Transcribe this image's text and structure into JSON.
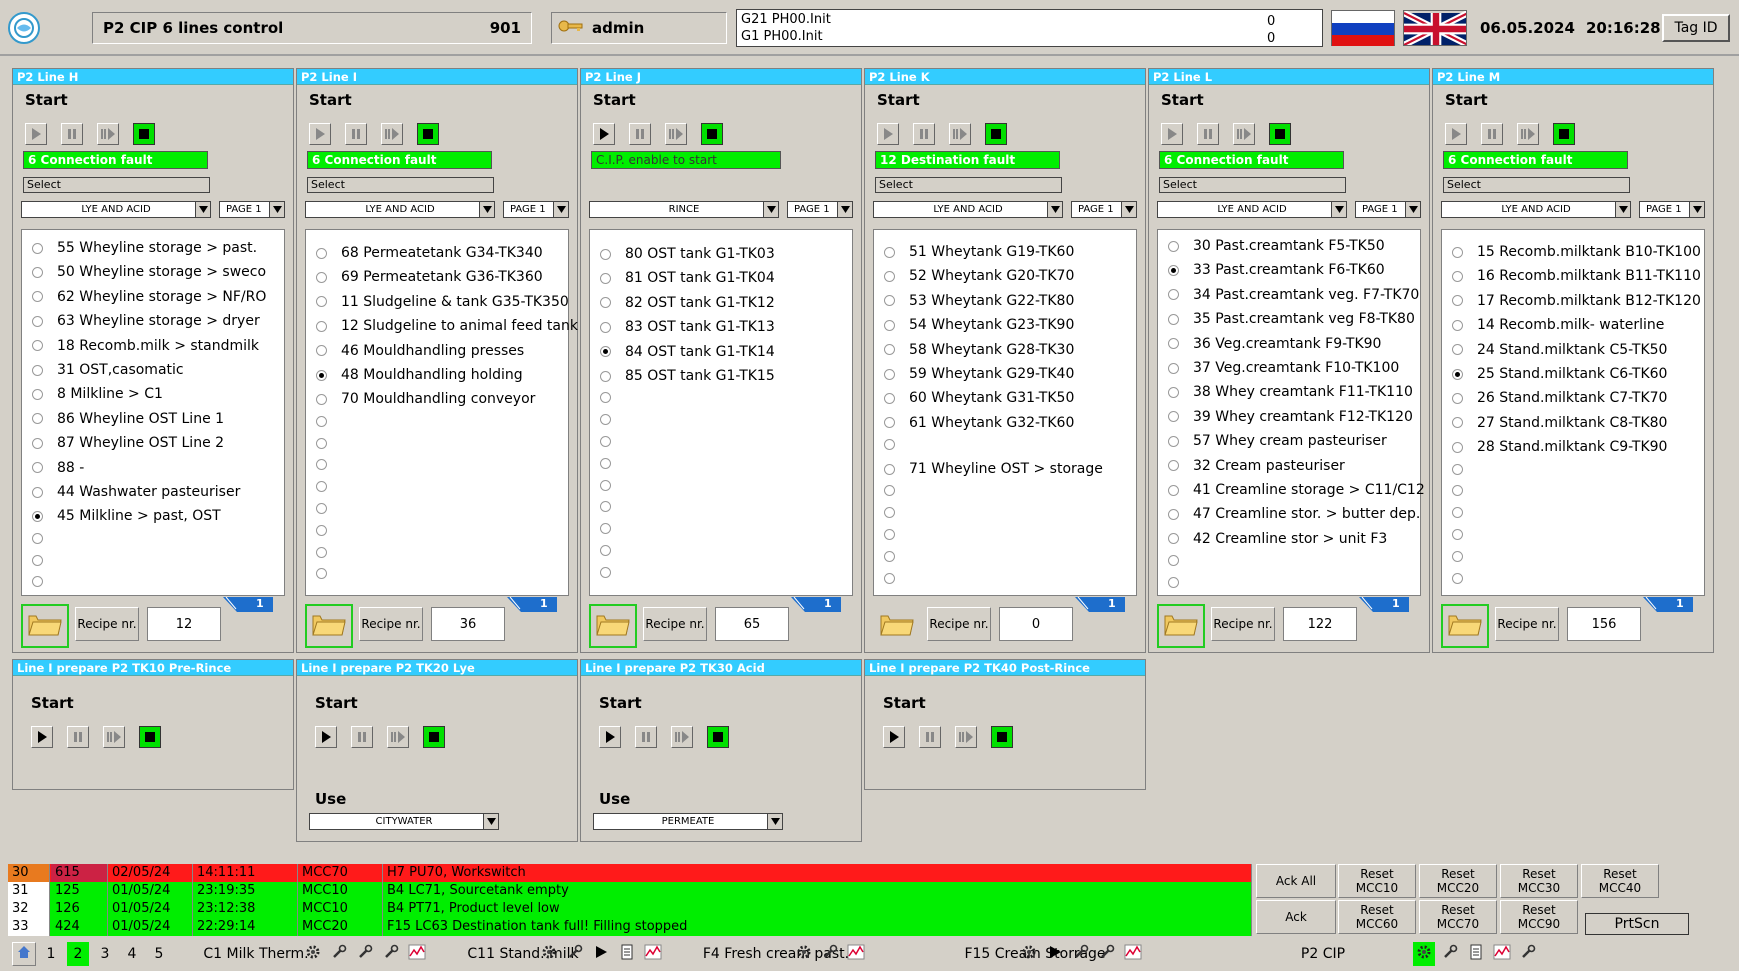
{
  "header": {
    "title": "P2 CIP 6 lines control",
    "code": "901",
    "user": "admin",
    "messages": [
      {
        "label": "G21  PH00.Init",
        "value": "0"
      },
      {
        "label": "G1   PH00.Init",
        "value": "0"
      }
    ],
    "date": "06.05.2024",
    "time": "20:16:28",
    "tag_id": "Tag ID"
  },
  "common": {
    "start": "Start",
    "select": "Select",
    "recipe_btn": "Recipe nr.",
    "use": "Use",
    "badge": "1"
  },
  "lines": [
    {
      "title": "P2 Line H",
      "fault": "6 Connection fault",
      "program": "LYE AND ACID",
      "page": "PAGE 1",
      "recipe": "12",
      "items": [
        {
          "t": "55 Wheyline storage > past.",
          "on": false
        },
        {
          "t": "50 Wheyline storage > sweco",
          "on": false
        },
        {
          "t": "62 Wheyline storage > NF/RO",
          "on": false
        },
        {
          "t": "63 Wheyline storage > dryer",
          "on": false
        },
        {
          "t": "18 Recomb.milk > standmilk",
          "on": false
        },
        {
          "t": "31 OST,casomatic",
          "on": false
        },
        {
          "t": "8 Milkline > C1",
          "on": false
        },
        {
          "t": "86 Wheyline OST  Line 1",
          "on": false
        },
        {
          "t": "87 Wheyline OST Line 2",
          "on": false
        },
        {
          "t": "88 -",
          "on": false
        },
        {
          "t": "44 Washwater pasteuriser",
          "on": false
        },
        {
          "t": "45 Milkline > past, OST",
          "on": true
        },
        {
          "t": "",
          "on": false
        },
        {
          "t": "",
          "on": false
        },
        {
          "t": "",
          "on": false
        }
      ]
    },
    {
      "title": "P2 Line I",
      "fault": "6 Connection fault",
      "program": "LYE AND ACID",
      "page": "PAGE 1",
      "recipe": "36",
      "items": [
        {
          "t": "68 Permeatetank G34-TK340",
          "on": false
        },
        {
          "t": "69 Permeatetank G36-TK360",
          "on": false
        },
        {
          "t": "11 Sludgeline & tank G35-TK350",
          "on": false
        },
        {
          "t": "12 Sludgeline to animal feed tank",
          "on": false
        },
        {
          "t": "46 Mouldhandling presses",
          "on": false
        },
        {
          "t": "48 Mouldhandling holding",
          "on": true
        },
        {
          "t": "70 Mouldhandling conveyor",
          "on": false
        },
        {
          "t": "",
          "on": false
        },
        {
          "t": "",
          "on": false
        },
        {
          "t": "",
          "on": false
        },
        {
          "t": "",
          "on": false
        },
        {
          "t": "",
          "on": false
        },
        {
          "t": "",
          "on": false
        },
        {
          "t": "",
          "on": false
        },
        {
          "t": "",
          "on": false
        }
      ]
    },
    {
      "title": "P2 Line J",
      "fault": "C.I.P. enable to start",
      "program": "RINCE",
      "page": "PAGE 1",
      "recipe": "65",
      "items": [
        {
          "t": "80 OST tank G1-TK03",
          "on": false
        },
        {
          "t": "81 OST tank G1-TK04",
          "on": false
        },
        {
          "t": "82 OST tank G1-TK12",
          "on": false
        },
        {
          "t": "83 OST tank G1-TK13",
          "on": false
        },
        {
          "t": "84 OST tank G1-TK14",
          "on": true
        },
        {
          "t": "85 OST tank G1-TK15",
          "on": false
        },
        {
          "t": "",
          "on": false
        },
        {
          "t": "",
          "on": false
        },
        {
          "t": "",
          "on": false
        },
        {
          "t": "",
          "on": false
        },
        {
          "t": "",
          "on": false
        },
        {
          "t": "",
          "on": false
        },
        {
          "t": "",
          "on": false
        },
        {
          "t": "",
          "on": false
        },
        {
          "t": "",
          "on": false
        }
      ]
    },
    {
      "title": "P2 Line K",
      "fault": "12 Destination fault",
      "program": "LYE AND ACID",
      "page": "PAGE 1",
      "recipe": "0",
      "items": [
        {
          "t": "51 Wheytank G19-TK60",
          "on": false
        },
        {
          "t": "52 Wheytank G20-TK70",
          "on": false
        },
        {
          "t": "53 Wheytank G22-TK80",
          "on": false
        },
        {
          "t": "54 Wheytank G23-TK90",
          "on": false
        },
        {
          "t": "58 Wheytank G28-TK30",
          "on": false
        },
        {
          "t": "59 Wheytank G29-TK40",
          "on": false
        },
        {
          "t": "60 Wheytank G31-TK50",
          "on": false
        },
        {
          "t": "61 Wheytank G32-TK60",
          "on": false
        },
        {
          "t": "",
          "on": false
        },
        {
          "t": "71 Wheyline OST > storage",
          "on": false
        },
        {
          "t": "",
          "on": false
        },
        {
          "t": "",
          "on": false
        },
        {
          "t": "",
          "on": false
        },
        {
          "t": "",
          "on": false
        },
        {
          "t": "",
          "on": false
        }
      ]
    },
    {
      "title": "P2 Line L",
      "fault": "6 Connection fault",
      "program": "LYE AND ACID",
      "page": "PAGE 1",
      "recipe": "122",
      "items": [
        {
          "t": "30 Past.creamtank F5-TK50",
          "on": false
        },
        {
          "t": "33 Past.creamtank F6-TK60",
          "on": true
        },
        {
          "t": "34 Past.creamtank veg. F7-TK70",
          "on": false
        },
        {
          "t": "35 Past.creamtank veg F8-TK80",
          "on": false
        },
        {
          "t": "36 Veg.creamtank F9-TK90",
          "on": false
        },
        {
          "t": "37 Veg.creamtank F10-TK100",
          "on": false
        },
        {
          "t": "38 Whey creamtank F11-TK110",
          "on": false
        },
        {
          "t": "39 Whey creamtank F12-TK120",
          "on": false
        },
        {
          "t": "57 Whey cream pasteuriser",
          "on": false
        },
        {
          "t": "32 Cream pasteuriser",
          "on": false
        },
        {
          "t": "41 Creamline storage > C11/C12",
          "on": false
        },
        {
          "t": "47 Creamline stor. > butter dep.",
          "on": false
        },
        {
          "t": "42 Creamline stor > unit F3",
          "on": false
        },
        {
          "t": "",
          "on": false
        },
        {
          "t": "",
          "on": false
        }
      ]
    },
    {
      "title": "P2 Line M",
      "fault": "6 Connection fault",
      "program": "LYE AND ACID",
      "page": "PAGE 1",
      "recipe": "156",
      "items": [
        {
          "t": "15 Recomb.milktank B10-TK100",
          "on": false
        },
        {
          "t": "16 Recomb.milktank B11-TK110",
          "on": false
        },
        {
          "t": "17 Recomb.milktank B12-TK120",
          "on": false
        },
        {
          "t": "14 Recomb.milk- waterline",
          "on": false
        },
        {
          "t": "24 Stand.milktank C5-TK50",
          "on": false
        },
        {
          "t": "25 Stand.milktank C6-TK60",
          "on": true
        },
        {
          "t": "26 Stand.milktank C7-TK70",
          "on": false
        },
        {
          "t": "27 Stand.milktank C8-TK80",
          "on": false
        },
        {
          "t": "28 Stand.milktank C9-TK90",
          "on": false
        },
        {
          "t": "",
          "on": false
        },
        {
          "t": "",
          "on": false
        },
        {
          "t": "",
          "on": false
        },
        {
          "t": "",
          "on": false
        },
        {
          "t": "",
          "on": false
        },
        {
          "t": "",
          "on": false
        }
      ]
    }
  ],
  "prepare": [
    {
      "title": "Line I prepare P2 TK10 Pre-Rince",
      "use": null
    },
    {
      "title": "Line I prepare P2 TK20 Lye",
      "use": "CITYWATER"
    },
    {
      "title": "Line I prepare P2 TK30 Acid",
      "use": "PERMEATE"
    },
    {
      "title": "Line I prepare P2 TK40 Post-Rince",
      "use": null
    }
  ],
  "alarms": [
    {
      "n": "30",
      "code": "615",
      "date": "02/05/24",
      "time": "14:11:11",
      "mcc": "MCC70",
      "msg": "H7 PU70, Workswitch",
      "color": "#ff1a1a",
      "first": "#e87a1f",
      "codecol": "#cc2244"
    },
    {
      "n": "31",
      "code": "125",
      "date": "01/05/24",
      "time": "23:19:35",
      "mcc": "MCC10",
      "msg": "B4 LC71, Sourcetank empty",
      "color": "#00ee00",
      "first": "#ffffff",
      "codecol": "#00ee00"
    },
    {
      "n": "32",
      "code": "126",
      "date": "01/05/24",
      "time": "23:12:38",
      "mcc": "MCC10",
      "msg": "B4 PT71, Product level low",
      "color": "#00ee00",
      "first": "#ffffff",
      "codecol": "#00ee00"
    },
    {
      "n": "33",
      "code": "424",
      "date": "01/05/24",
      "time": "22:29:14",
      "mcc": "MCC20",
      "msg": "F15 LC63 Destination tank full! Filling stopped",
      "color": "#00ee00",
      "first": "#ffffff",
      "codecol": "#00ee00"
    }
  ],
  "alarm_buttons": {
    "ack_all": "Ack All",
    "ack": "Ack",
    "reset_top": [
      "Reset MCC10",
      "Reset MCC20",
      "Reset MCC30",
      "Reset MCC40"
    ],
    "reset_bottom": [
      "Reset MCC60",
      "Reset MCC70",
      "Reset MCC90"
    ],
    "prtscn": "PrtScn"
  },
  "bottombar": {
    "pages": [
      "1",
      "2",
      "3",
      "4",
      "5"
    ],
    "active_page": "2",
    "sections": [
      "C1 Milk Therm.",
      "C11 Stand. milk",
      "F4 Fresh cream past.",
      "F15 Cream Storrage",
      "P2 CIP"
    ]
  },
  "colors": {
    "title_bar": "#33ccff",
    "active_green": "#00ee00",
    "alarm_red": "#ff1a1a"
  }
}
